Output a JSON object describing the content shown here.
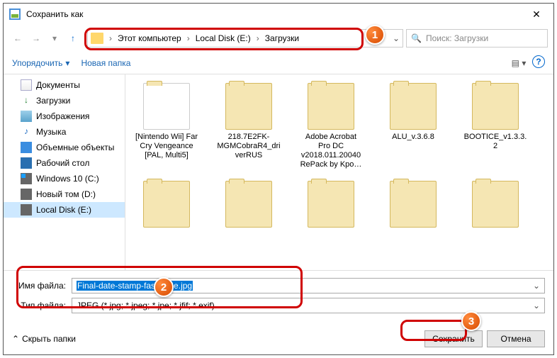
{
  "title": "Сохранить как",
  "breadcrumb": {
    "root": "Этот компьютер",
    "drive": "Local Disk (E:)",
    "folder": "Загрузки"
  },
  "search_placeholder": "Поиск: Загрузки",
  "toolbar": {
    "organize": "Упорядочить",
    "newfolder": "Новая папка"
  },
  "sidebar": [
    {
      "label": "Документы",
      "icon": "i-doc"
    },
    {
      "label": "Загрузки",
      "icon": "i-dl"
    },
    {
      "label": "Изображения",
      "icon": "i-img"
    },
    {
      "label": "Музыка",
      "icon": "i-mus"
    },
    {
      "label": "Объемные объекты",
      "icon": "i-cube"
    },
    {
      "label": "Рабочий стол",
      "icon": "i-desk"
    },
    {
      "label": "Windows 10 (C:)",
      "icon": "i-drvw"
    },
    {
      "label": "Новый том (D:)",
      "icon": "i-drv"
    },
    {
      "label": "Local Disk (E:)",
      "icon": "i-drv",
      "sel": true
    }
  ],
  "files": [
    {
      "name": "[Nintendo Wii] Far Cry Vengeance [PAL, Multi5]",
      "img": true
    },
    {
      "name": "218.7E2FK-MGMCobraR4_driverRUS"
    },
    {
      "name": "Adobe Acrobat Pro DC v2018.011.20040 RePack by Kpo…"
    },
    {
      "name": "ALU_v.3.6.8"
    },
    {
      "name": "BOOTICE_v1.3.3.2"
    }
  ],
  "labels": {
    "filename": "Имя файла:",
    "filetype": "Тип файла:",
    "hide": "Скрыть папки",
    "save": "Сохранить",
    "cancel": "Отмена"
  },
  "values": {
    "filename": "Final-date-stamp-faststone.jpg",
    "filetype": "JPEG (*.jpg; *.jpeg; *.jpe; *.jfif; *.exif)"
  },
  "badges": {
    "b1": "1",
    "b2": "2",
    "b3": "3"
  }
}
